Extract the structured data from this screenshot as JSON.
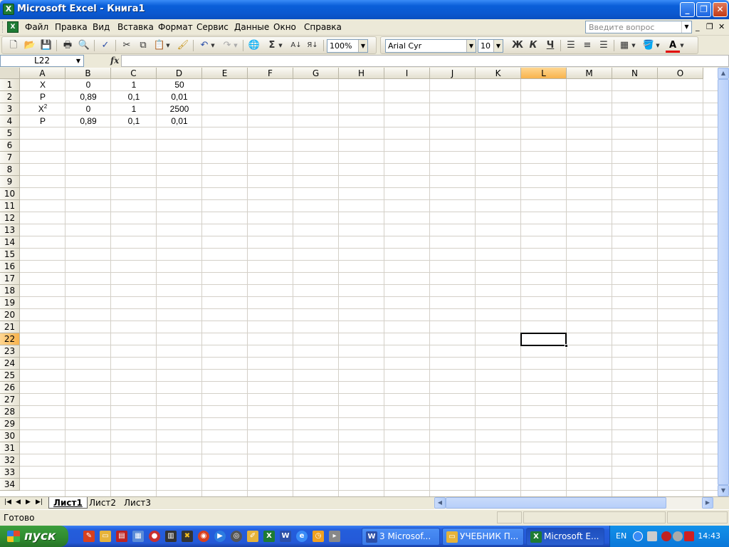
{
  "window": {
    "title": "Microsoft Excel - Книга1"
  },
  "menu": [
    "Файл",
    "Правка",
    "Вид",
    "Вставка",
    "Формат",
    "Сервис",
    "Данные",
    "Окно",
    "Справка"
  ],
  "help": {
    "placeholder": "Введите вопрос"
  },
  "toolbar": {
    "zoom": "100%",
    "font": "Arial Cyr",
    "size": "10",
    "bold": "Ж",
    "italic": "К",
    "underline": "Ч",
    "sum": "Σ"
  },
  "namebox": "L22",
  "fx": "fx",
  "columns": [
    "A",
    "B",
    "C",
    "D",
    "E",
    "F",
    "G",
    "H",
    "I",
    "J",
    "K",
    "L",
    "M",
    "N",
    "O"
  ],
  "selected_column": "L",
  "selected_row": "22",
  "rows": [
    "1",
    "2",
    "3",
    "4",
    "5",
    "6",
    "7",
    "8",
    "9",
    "10",
    "11",
    "12",
    "13",
    "14",
    "15",
    "16",
    "17",
    "18",
    "19",
    "20",
    "21",
    "22",
    "23",
    "24",
    "25",
    "26",
    "27",
    "28",
    "29",
    "30",
    "31",
    "32",
    "33",
    "34"
  ],
  "cells": {
    "r1": [
      "X",
      "0",
      "1",
      "50"
    ],
    "r2": [
      "P",
      "0,89",
      "0,1",
      "0,01"
    ],
    "r3": {
      "a": "X",
      "a_sup": "2",
      "b": "0",
      "c": "1",
      "d": "2500"
    },
    "r4": [
      "P",
      "0,89",
      "0,1",
      "0,01"
    ]
  },
  "sheets": [
    "Лист1",
    "Лист2",
    "Лист3"
  ],
  "status": "Готово",
  "taskbar": {
    "start": "пуск",
    "tasks": [
      "3 Microsof...",
      "УЧЕБНИК П...",
      "Microsoft E..."
    ],
    "lang": "EN",
    "clock": "14:43"
  }
}
